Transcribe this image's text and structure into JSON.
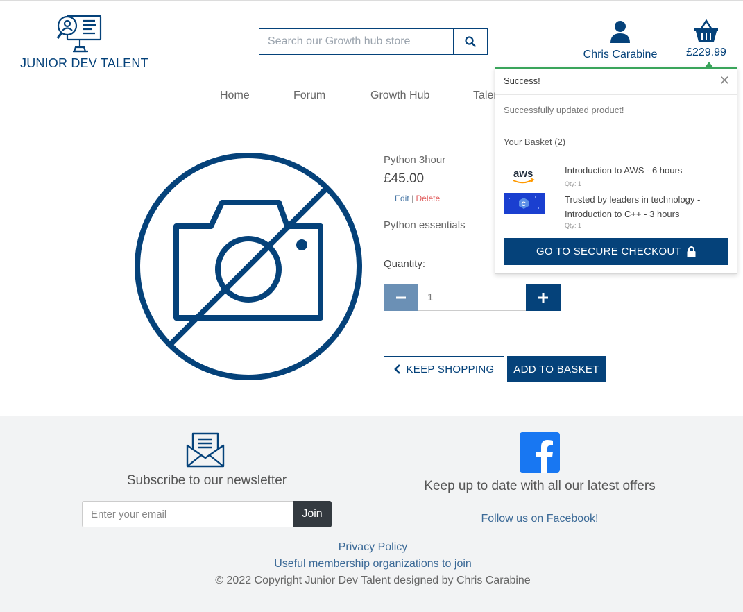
{
  "brand": {
    "name": "JUNIOR DEV TALENT"
  },
  "search": {
    "placeholder": "Search our Growth hub store"
  },
  "account": {
    "name": "Chris Carabine"
  },
  "basket": {
    "total": "£229.99"
  },
  "nav": {
    "items": [
      "Home",
      "Forum",
      "Growth Hub",
      "Talen"
    ]
  },
  "product": {
    "name": "Python 3hour",
    "price": "£45.00",
    "edit_label": "Edit",
    "separator": "|",
    "delete_label": "Delete",
    "description": "Python essentials",
    "quantity_label": "Quantity:",
    "quantity_value": "1",
    "keep_shopping_label": "KEEP SHOPPING",
    "add_to_basket_label": "ADD TO BASKET"
  },
  "toast": {
    "title": "Success!",
    "close_glyph": "✕",
    "message": "Successfully updated product!",
    "basket_heading": "Your Basket (2)",
    "items": [
      {
        "title": "Introduction to AWS - 6 hours",
        "qty": "Qty: 1",
        "thumb_text": "aws"
      },
      {
        "title": "Trusted by leaders in technology - Introduction to C++ - 3 hours",
        "qty": "Qty: 1",
        "thumb_text": "C"
      }
    ],
    "checkout_label": "GO TO SECURE CHECKOUT"
  },
  "footer": {
    "newsletter_title": "Subscribe to our newsletter",
    "email_placeholder": "Enter your email",
    "join_label": "Join",
    "facebook_title": "Keep up to date with all our latest offers",
    "facebook_link": "Follow us on Facebook!",
    "privacy_link": "Privacy Policy",
    "orgs_link": "Useful membership organizations to join",
    "copyright": "© 2022 Copyright Junior Dev Talent designed by Chris Carabine"
  },
  "colors": {
    "brand": "#05427a",
    "success": "#3aa55b",
    "facebook": "#1877f2",
    "delete": "#e05a5a"
  },
  "icons": [
    "logo-magnifier-icon",
    "search-icon",
    "user-icon",
    "basket-icon",
    "no-camera-icon",
    "minus-icon",
    "plus-icon",
    "chevron-left-icon",
    "lock-icon",
    "envelope-icon",
    "facebook-icon",
    "close-icon"
  ]
}
